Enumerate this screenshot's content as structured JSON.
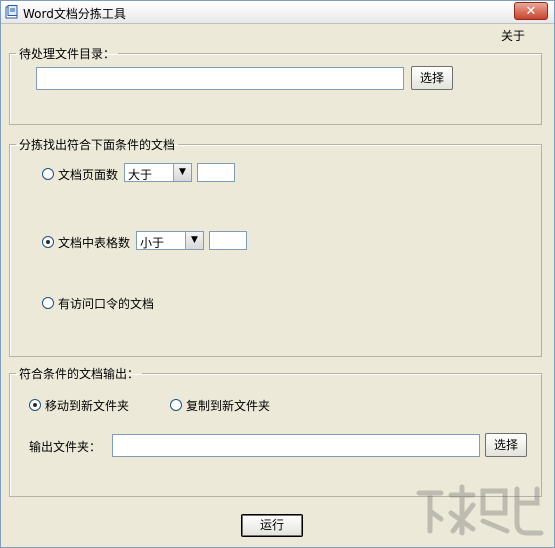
{
  "window": {
    "title": "Word文档分拣工具",
    "close_symbol": "✕"
  },
  "menu": {
    "about": "关于"
  },
  "input_section": {
    "legend": "待处理文件目录：",
    "dir_value": "",
    "browse_label": "选择"
  },
  "criteria_section": {
    "legend": "分拣找出符合下面条件的文档",
    "page_count": {
      "label": "文档页面数",
      "operator": "大于",
      "value": "",
      "checked": false
    },
    "table_count": {
      "label": "文档中表格数",
      "operator": "小于",
      "value": "",
      "checked": true
    },
    "password": {
      "label": "有访问口令的文档",
      "checked": false
    }
  },
  "output_section": {
    "legend": "符合条件的文档输出：",
    "move_label": "移动到新文件夹",
    "copy_label": "复制到新文件夹",
    "folder_label": "输出文件夹：",
    "folder_value": "",
    "browse_label": "选择"
  },
  "run_label": "运行"
}
